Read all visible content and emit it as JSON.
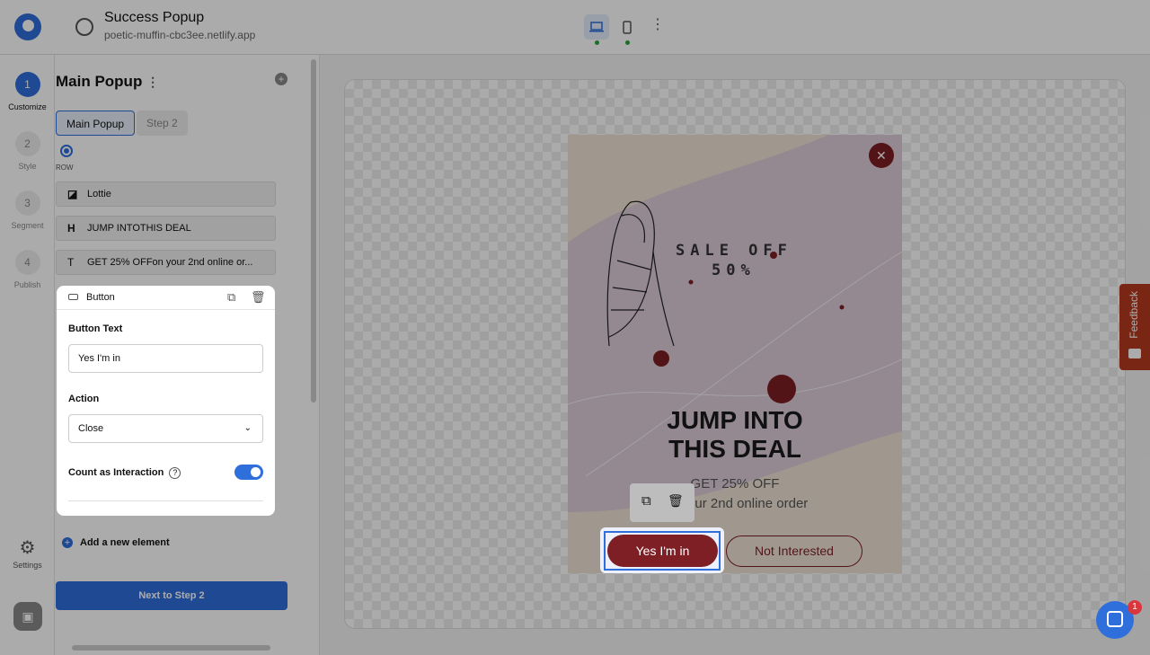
{
  "header": {
    "title": "Success Popup",
    "subtitle": "poetic-muffin-cbc3ee.netlify.app",
    "devices": [
      "desktop-icon",
      "mobile-icon"
    ]
  },
  "steps": [
    {
      "n": "1",
      "label": "Customize"
    },
    {
      "n": "2",
      "label": "Style"
    },
    {
      "n": "3",
      "label": "Segment"
    },
    {
      "n": "4",
      "label": "Publish"
    }
  ],
  "settings_label": "Settings",
  "panel": {
    "title": "Main Popup",
    "tabs": [
      "Main Popup",
      "Step 2"
    ],
    "row_label": "ROW",
    "elements": [
      {
        "icon": "lottie-icon",
        "glyph": "◪",
        "label": "Lottie"
      },
      {
        "icon": "heading-icon",
        "glyph": "H",
        "label": "JUMP INTOTHIS DEAL"
      },
      {
        "icon": "text-icon",
        "glyph": "T",
        "label": "GET 25% OFFon your 2nd online or..."
      }
    ],
    "button_el": {
      "label": "Button",
      "text_label": "Button Text",
      "text_value": "Yes I'm in",
      "action_label": "Action",
      "action_value": "Close",
      "interaction_label": "Count as Interaction",
      "interaction_on": true
    },
    "add_label": "Add a new element",
    "next_label": "Next to Step 2"
  },
  "popup": {
    "sale_line1": "SALE OFF",
    "sale_line2": "50%",
    "heading_line1": "JUMP INTO",
    "heading_line2": "THIS DEAL",
    "sub_line1": "GET 25% OFF",
    "sub_line2": "on your 2nd online order",
    "primary": "Yes I'm in",
    "secondary": "Not Interested",
    "accent": "#7d1f25"
  },
  "feedback_label": "Feedback",
  "chat_badge": "1",
  "colors": {
    "brand": "#2f6fdb",
    "feedback": "#b5391f"
  }
}
